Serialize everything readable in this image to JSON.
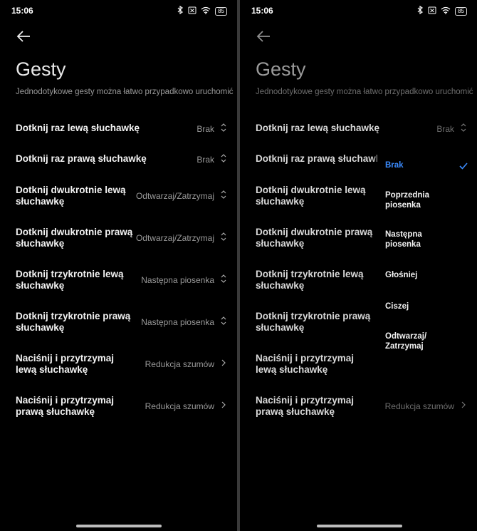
{
  "status": {
    "time": "15:06",
    "battery": "85"
  },
  "page": {
    "title": "Gesty",
    "subtitle": "Jednodotykowe gesty można łatwo przypadkowo uruchomić"
  },
  "settings": [
    {
      "label": "Dotknij raz lewą słuchawkę",
      "value": "Brak"
    },
    {
      "label": "Dotknij raz prawą słuchawkę",
      "value": "Brak"
    },
    {
      "label": "Dotknij dwukrotnie lewą słuchawkę",
      "value": "Odtwarzaj/Zatrzymaj"
    },
    {
      "label": "Dotknij dwukrotnie prawą słuchawkę",
      "value": "Odtwarzaj/Zatrzymaj"
    },
    {
      "label": "Dotknij trzykrotnie lewą słuchawkę",
      "value": "Następna piosenka"
    },
    {
      "label": "Dotknij trzykrotnie prawą słuchawkę",
      "value": "Następna piosenka"
    },
    {
      "label": "Naciśnij i przytrzymaj lewą słuchawkę",
      "value": "Redukcja szumów"
    },
    {
      "label": "Naciśnij i przytrzymaj prawą słuchawkę",
      "value": "Redukcja szumów"
    }
  ],
  "dropdown": {
    "options": [
      "Brak",
      "Poprzednia piosenka",
      "Następna piosenka",
      "Głośniej",
      "Ciszej",
      "Odtwarzaj/ Zatrzymaj"
    ],
    "selected": "Brak",
    "accent_color": "#3b8cff"
  }
}
